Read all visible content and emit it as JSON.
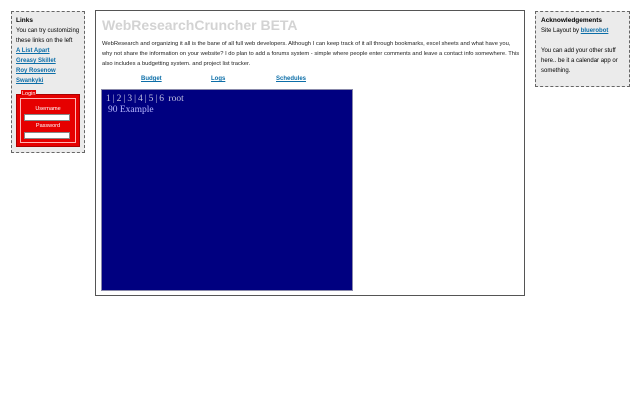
{
  "left": {
    "heading": "Links",
    "intro": "You can try customizing these links on the left",
    "links": [
      "A List Apart",
      "Greasy Skillet",
      "Roy Rosenow",
      "Swankyki"
    ],
    "login": {
      "legend": "Login",
      "username_label": "Username",
      "password_label": "Password"
    }
  },
  "main": {
    "title": "WebResearchCruncher BETA",
    "intro": "WebResearch and organizing it all is the bane of all full web developers. Although I can keep track of it all through bookmarks, excel sheets and what have you, why not share the information on your website? I do plan to add a forums system - simple where people enter comments and leave a contact info somewhere. This also includes a budgetting system. and project list tracker.",
    "nav": [
      "Budget",
      "Logs",
      "Schedules"
    ],
    "panel": {
      "pages": [
        "1",
        "2",
        "3",
        "4",
        "5",
        "6"
      ],
      "root_label": "root",
      "example": "90 Example"
    }
  },
  "right": {
    "heading": "Acknowledgements",
    "credit_prefix": "Site Layout by",
    "credit_link": "bluerobot",
    "note": "You can add your other stuff here.. be it a calendar app or something."
  },
  "colors": {
    "panel_bg": "#000080",
    "link": "#0c6ea8",
    "login_bg": "#e60000",
    "sidebar_bg": "#ebebeb"
  }
}
